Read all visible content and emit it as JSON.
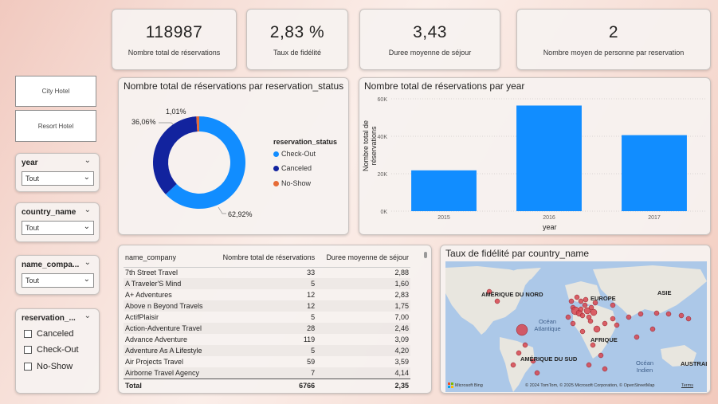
{
  "kpis": [
    {
      "value": "118987",
      "label": "Nombre total de réservations"
    },
    {
      "value": "2,83 %",
      "label": "Taux de fidélité"
    },
    {
      "value": "3,43",
      "label": "Duree moyenne de séjour"
    },
    {
      "value": "2",
      "label": "Nombre moyen de personne par reservation"
    }
  ],
  "hotel_buttons": [
    "City Hotel",
    "Resort Hotel"
  ],
  "slicers": {
    "year": {
      "title": "year",
      "value": "Tout"
    },
    "country": {
      "title": "country_name",
      "value": "Tout"
    },
    "company": {
      "title": "name_compa...",
      "value": "Tout"
    },
    "status": {
      "title": "reservation_...",
      "options": [
        "Canceled",
        "Check-Out",
        "No-Show"
      ]
    }
  },
  "donut": {
    "title": "Nombre total de réservations par reservation_status",
    "legend_title": "reservation_status",
    "labels": {
      "canceled_pct": "36,06%",
      "noshow_pct": "1,01%",
      "checkout_pct": "62,92%"
    },
    "chart_data": {
      "type": "pie",
      "categories": [
        "Check-Out",
        "Canceled",
        "No-Show"
      ],
      "values": [
        62.92,
        36.06,
        1.01
      ],
      "colors": [
        "#118dff",
        "#12239e",
        "#e66c37"
      ]
    }
  },
  "bar": {
    "title": "Nombre total de réservations par year",
    "chart_data": {
      "type": "bar",
      "categories": [
        "2015",
        "2016",
        "2017"
      ],
      "values": [
        21800,
        56400,
        40600
      ],
      "xlabel": "year",
      "ylabel": "Nombre total de réservations",
      "ylim": [
        0,
        60000
      ],
      "yticks": [
        "0K",
        "20K",
        "40K",
        "60K"
      ],
      "color": "#118dff"
    }
  },
  "table": {
    "headers": [
      "name_company",
      "Nombre total de réservations",
      "Duree moyenne de séjour"
    ],
    "rows": [
      [
        "7th Street Travel",
        "33",
        "2,88"
      ],
      [
        "A Traveler'S Mind",
        "5",
        "1,60"
      ],
      [
        "A+ Adventures",
        "12",
        "2,83"
      ],
      [
        "Above n Beyond Travels",
        "12",
        "1,75"
      ],
      [
        "ActifPlaisir",
        "5",
        "7,00"
      ],
      [
        "Action-Adventure Travel",
        "28",
        "2,46"
      ],
      [
        "Advance Adventure",
        "119",
        "3,09"
      ],
      [
        "Adventure As A Lifestyle",
        "5",
        "4,20"
      ],
      [
        "Air Projects Travel",
        "59",
        "3,59"
      ],
      [
        "Airborne Travel Agency",
        "7",
        "4,14"
      ]
    ],
    "total": [
      "Total",
      "6766",
      "2,35"
    ]
  },
  "map": {
    "title": "Taux de fidélité par country_name",
    "continents": [
      "AMÉRIQUE DU NORD",
      "EUROPE",
      "ASIE",
      "AFRIQUE",
      "AMÉRIQUE DU SUD",
      "AUSTRAL"
    ],
    "oceans": [
      "Océan Atlantique",
      "Océan Indien"
    ],
    "logo": "Microsoft Bing",
    "credit": "© 2024 TomTom, © 2025 Microsoft Corporation, © OpenStreetMap",
    "terms": "Terms"
  }
}
